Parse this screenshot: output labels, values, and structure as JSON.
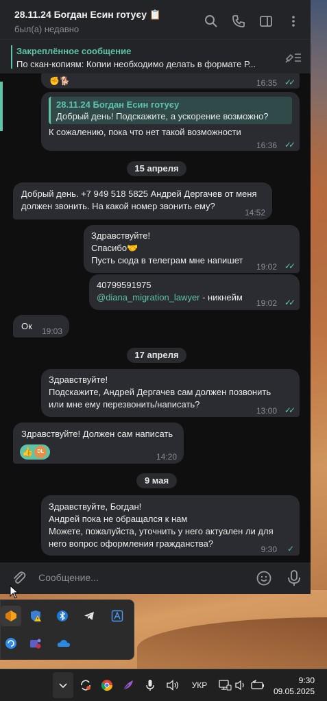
{
  "header": {
    "title": "28.11.24 Богдан Есин готуєу 📋",
    "status": "был(а) недавно",
    "icons": [
      "search-icon",
      "phone-icon",
      "sidebar-icon",
      "more-icon"
    ]
  },
  "pinned": {
    "title": "Закреплённое сообщение",
    "text": "По скан-копиям: Копии необходимо делать в формате Р..."
  },
  "messages": {
    "m0": {
      "time": "16:35"
    },
    "m1": {
      "reply_title": "28.11.24 Богдан Есин готуєу",
      "reply_text": "Добрый день! Подскажите, а ускорение возможно?",
      "text": "К сожалению, пока что нет такой возможности",
      "time": "16:36"
    },
    "d1": "15 апреля",
    "m2": {
      "l1": "Добрый день. +7 949 518 5825 Андрей Дергачев от меня",
      "l2": "должен звонить. На какой номер звонить ему?",
      "time": "14:52"
    },
    "m3": {
      "l1": "Здравствуйте!",
      "l2": "Спасибо🤝",
      "l3": "Пусть сюда в телеграм мне напишет",
      "time": "19:02"
    },
    "m4": {
      "l1": "40799591975",
      "link": "@diana_migration_lawyer",
      "suffix": " - никнейм",
      "time": "19:02"
    },
    "m5": {
      "text": "Ок",
      "time": "19:03"
    },
    "d2": "17 апреля",
    "m6": {
      "l1": "Здравствуйте!",
      "l2": "Подскажите, Андрей Дергачев сам должен позвонить",
      "l3": "или мне ему перезвонить/написать?",
      "time": "13:00"
    },
    "m7": {
      "text": "Здравствуйте! Должен сам написать",
      "reaction": "👍",
      "reaction_user": "DL",
      "time": "14:20"
    },
    "d3": "9 мая",
    "m8": {
      "l1": "Здравствуйте, Богдан!",
      "l2": "Андрей пока не обращался к нам",
      "l3": "Можете, пожалуйста,  уточнить  у него актуален ли для",
      "l4": "него вопрос оформления гражданства?",
      "time": "9:30"
    }
  },
  "composer": {
    "placeholder": "Сообщение..."
  },
  "taskbar": {
    "lang": "УКР",
    "time": "9:30",
    "date": "09.05.2025"
  },
  "colors": {
    "accent": "#5fc3a8",
    "bubble": "#2b2c31",
    "background": "#0f0f10"
  }
}
